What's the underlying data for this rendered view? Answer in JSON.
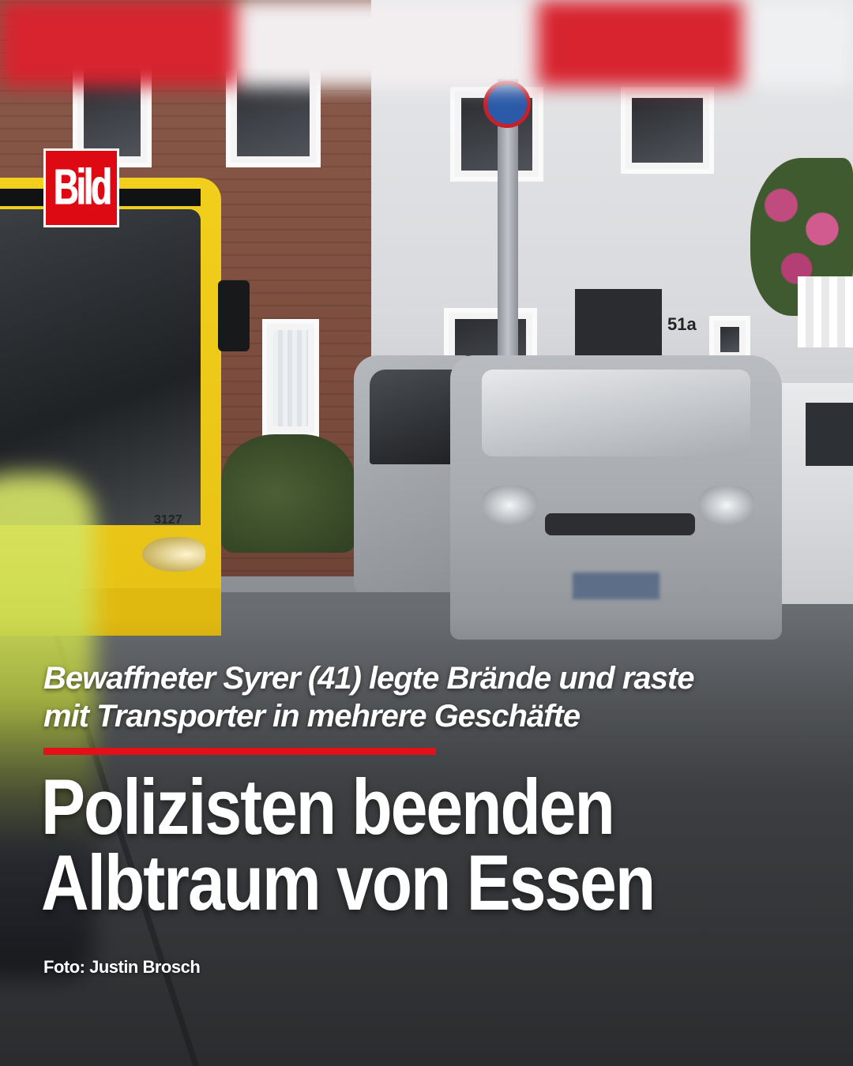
{
  "brand": {
    "logo_text": "Bild",
    "accent": "#dd0a14"
  },
  "photo": {
    "house_number": "51a",
    "bus_number": "3127"
  },
  "article": {
    "kicker_line_1": "Bewaffneter Syrer (41) legte Brände und raste",
    "kicker_line_2": "mit Transporter in mehrere Geschäfte",
    "headline_line_1": "Polizisten beenden",
    "headline_line_2": "Albtraum von Essen",
    "photo_credit": "Foto: Justin Brosch"
  },
  "colors": {
    "text": "#ffffff",
    "rule": "#e3101a",
    "bus_yellow": "#f2cf1c"
  }
}
